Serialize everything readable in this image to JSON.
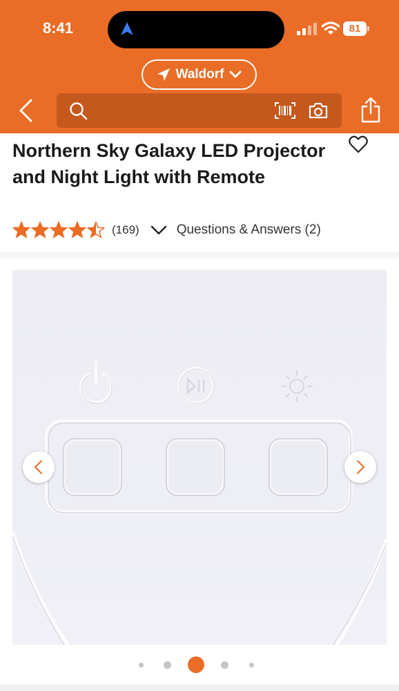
{
  "status_bar": {
    "time": "8:41",
    "battery": "81"
  },
  "header": {
    "location_label": "Waldorf",
    "search_placeholder": "",
    "brand_color": "#E96D26"
  },
  "product": {
    "title": "Northern Sky Galaxy LED Projector and Night Light with Remote",
    "rating": 4.5,
    "rating_max": 5,
    "review_count": "(169)",
    "qa_label": "Questions & Answers (2)"
  },
  "gallery": {
    "image_count": 5,
    "active_index": 2
  },
  "icons": {
    "back": "chevron-left-icon",
    "search": "search-icon",
    "barcode": "barcode-icon",
    "camera": "camera-icon",
    "share": "share-icon",
    "favorite": "heart-icon",
    "location": "location-arrow-icon"
  }
}
